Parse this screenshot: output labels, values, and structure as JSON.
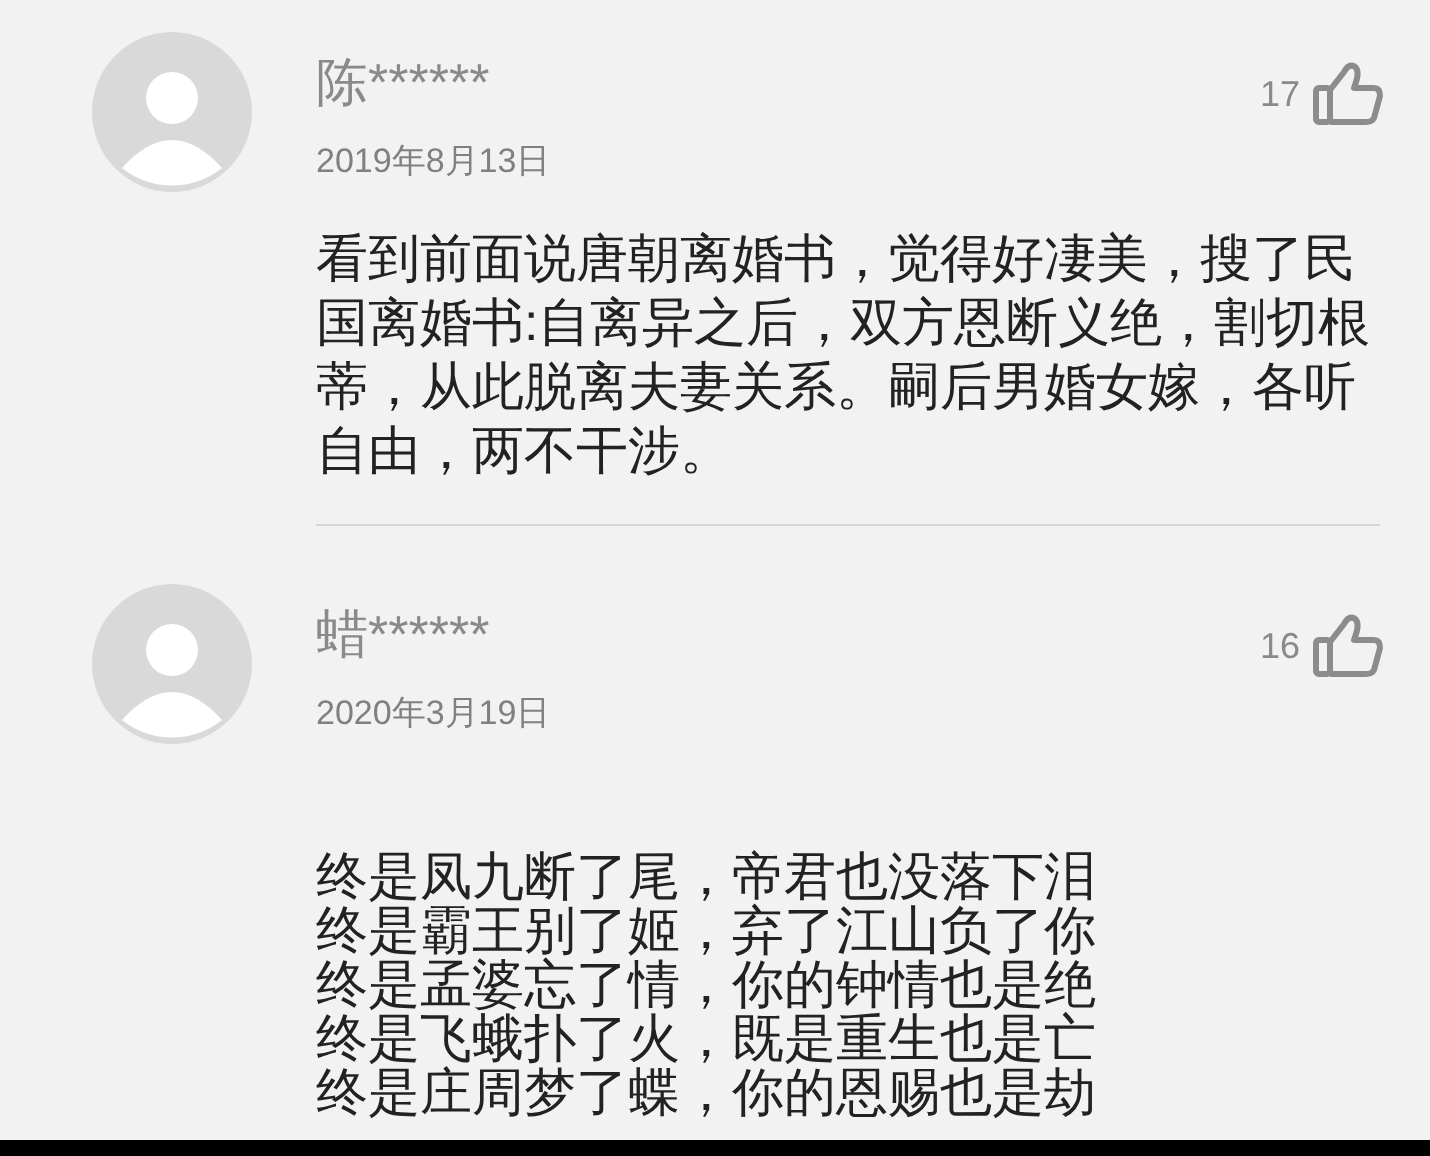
{
  "comments": [
    {
      "user": "陈******",
      "date": "2019年8月13日",
      "likes": "17",
      "kind": "paragraph",
      "lines": [
        "看到前面说唐朝离婚书，觉得好凄美，搜了民国离婚书:自离异之后，双方恩断义绝，割切根蒂，从此脱离夫妻关系。嗣后男婚女嫁，各听自由，两不干涉。"
      ]
    },
    {
      "user": "蜡******",
      "date": "2020年3月19日",
      "likes": "16",
      "kind": "verse",
      "lines": [
        "终是凤九断了尾，帝君也没落下泪",
        "终是霸王别了姬，弃了江山负了你",
        "终是孟婆忘了情，你的钟情也是绝",
        "终是飞蛾扑了火，既是重生也是亡",
        "终是庄周梦了蝶，你的恩赐也是劫"
      ]
    }
  ]
}
